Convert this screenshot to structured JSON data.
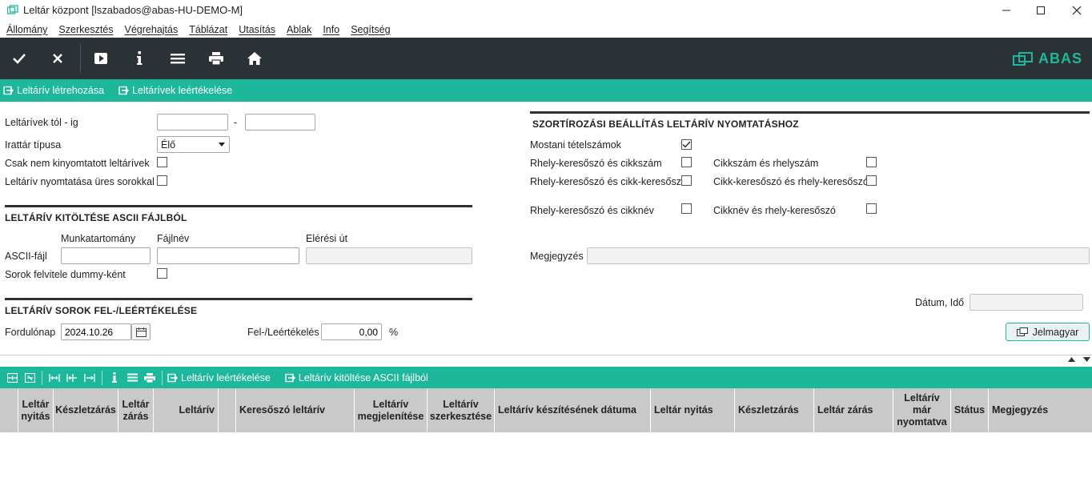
{
  "window": {
    "title": "Leltár központ  [lszabados@abas-HU-DEMO-M]"
  },
  "menu": [
    "Állomány",
    "Szerkesztés",
    "Végrehajtás",
    "Táblázat",
    "Utasítás",
    "Ablak",
    "Info",
    "Segítség"
  ],
  "toolbar": {
    "icons": [
      "check-icon",
      "close-icon",
      "play-icon",
      "info-icon",
      "list-icon",
      "print-icon",
      "home-icon"
    ],
    "brand": "ABAS",
    "brand_color": "#1db89b",
    "bg_color": "#2b3236"
  },
  "actions": {
    "create": "Leltárív létrehozása",
    "writedown": "Leltárívek leértékelése"
  },
  "form": {
    "range_label": "Leltárívek tól - ig",
    "range_dash": "-",
    "range_from": "",
    "range_to": "",
    "archive_type_label": "Irattár típusa",
    "archive_type_value": "Élő",
    "not_printed_label": "Csak nem kinyomtatott leltárívek",
    "print_empty_label": "Leltárív nyomtatása üres sorokkal"
  },
  "ascii": {
    "heading": "LELTÁRÍV KITÖLTÉSE ASCII FÁJLBÓL",
    "col_workarea": "Munkatartomány",
    "col_filename": "Fájlnév",
    "col_path": "Elérési út",
    "row_label": "ASCII-fájl",
    "workarea_value": "",
    "filename_value": "",
    "path_value": "",
    "dummy_label": "Sorok felvitele dummy-ként"
  },
  "revalue": {
    "heading": "LELTÁRÍV SOROK FEL-/LEÉRTÉKELÉSE",
    "date_label": "Fordulónap",
    "date_value": "2024.10.26",
    "pct_label": "Fel-/Leértékelés",
    "pct_value": "0,00",
    "pct_unit": "%"
  },
  "sort": {
    "heading": "SZORTÍROZÁSI BEÁLLÍTÁS LELTÁRÍV NYOMTATÁSHOZ",
    "current": "Mostani tételszámok",
    "opt1": "Rhely-keresőszó és cikkszám",
    "opt2": "Cikkszám és rhelyszám",
    "opt3": "Rhely-keresőszó és cikk-keresőszó",
    "opt4": "Cikk-keresőszó  és rhely-keresőszó",
    "opt5": "Rhely-keresőszó és cikknév",
    "opt6": "Cikknév és rhely-keresőszó",
    "note_label": "Megjegyzés",
    "note_value": "",
    "datetime_label": "Dátum, Idő",
    "datetime_value": "",
    "legend_button": "Jelmagyar"
  },
  "table_actions": {
    "writedown": "Leltárív leértékelése",
    "fill_ascii": "Leltárív kitöltése ASCII fájlból"
  },
  "table": {
    "columns": [
      "Leltár nyitás",
      "Készletzárás",
      "Leltár zárás",
      "Leltárív",
      "Keresőszó leltárív",
      "Leltárív megjelenítése",
      "Leltárív szerkesztése",
      "Leltárív készítésének dátuma",
      "Leltár nyitás",
      "Készletzárás",
      "Leltár zárás",
      "Leltárív már nyomtatva",
      "Státus",
      "Megjegyzés"
    ]
  }
}
